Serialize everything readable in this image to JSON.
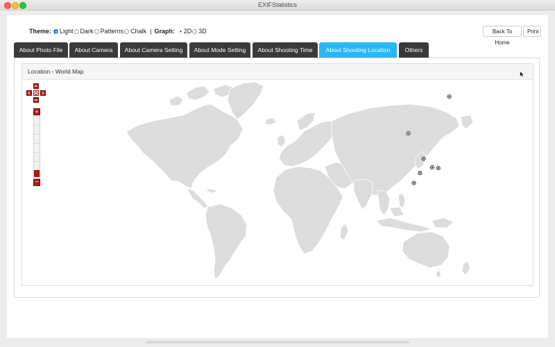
{
  "window": {
    "title": "EXIFStatistics"
  },
  "theme": {
    "label": "Theme:",
    "options": [
      {
        "label": "Light",
        "selected": true
      },
      {
        "label": "Dark",
        "selected": false
      },
      {
        "label": "Patterns",
        "selected": false
      },
      {
        "label": "Chalk",
        "selected": false
      }
    ],
    "separator": "|"
  },
  "graph": {
    "label": "Graph:",
    "options": [
      {
        "label": "2D",
        "selected": true
      },
      {
        "label": "3D",
        "selected": false
      }
    ]
  },
  "toolbar": {
    "home_label": "Back To Home",
    "print_label": "Print"
  },
  "tabs": [
    {
      "label": "About Photo File",
      "active": false
    },
    {
      "label": "About Camera",
      "active": false
    },
    {
      "label": "About Camera Setting",
      "active": false
    },
    {
      "label": "About Mode Setting",
      "active": false
    },
    {
      "label": "About Shooting Time",
      "active": false
    },
    {
      "label": "About Shooting Location",
      "active": true
    },
    {
      "label": "Others",
      "active": false
    }
  ],
  "panel": {
    "title": "Location - World Map"
  },
  "map": {
    "markers": [
      {
        "lat": 64.5,
        "lon": 135.0
      },
      {
        "lat": 38.8,
        "lon": 101.5
      },
      {
        "lat": 21.0,
        "lon": 114.0
      },
      {
        "lat": 15.0,
        "lon": 121.0
      },
      {
        "lat": 14.5,
        "lon": 126.0
      },
      {
        "lat": 11.0,
        "lon": 111.0
      },
      {
        "lat": 4.0,
        "lon": 106.0
      }
    ],
    "colors": {
      "land": "#dcdcdc",
      "border": "#ffffff",
      "marker": "#222222",
      "control": "#b01818",
      "accent_tab": "#29b6f6"
    }
  }
}
